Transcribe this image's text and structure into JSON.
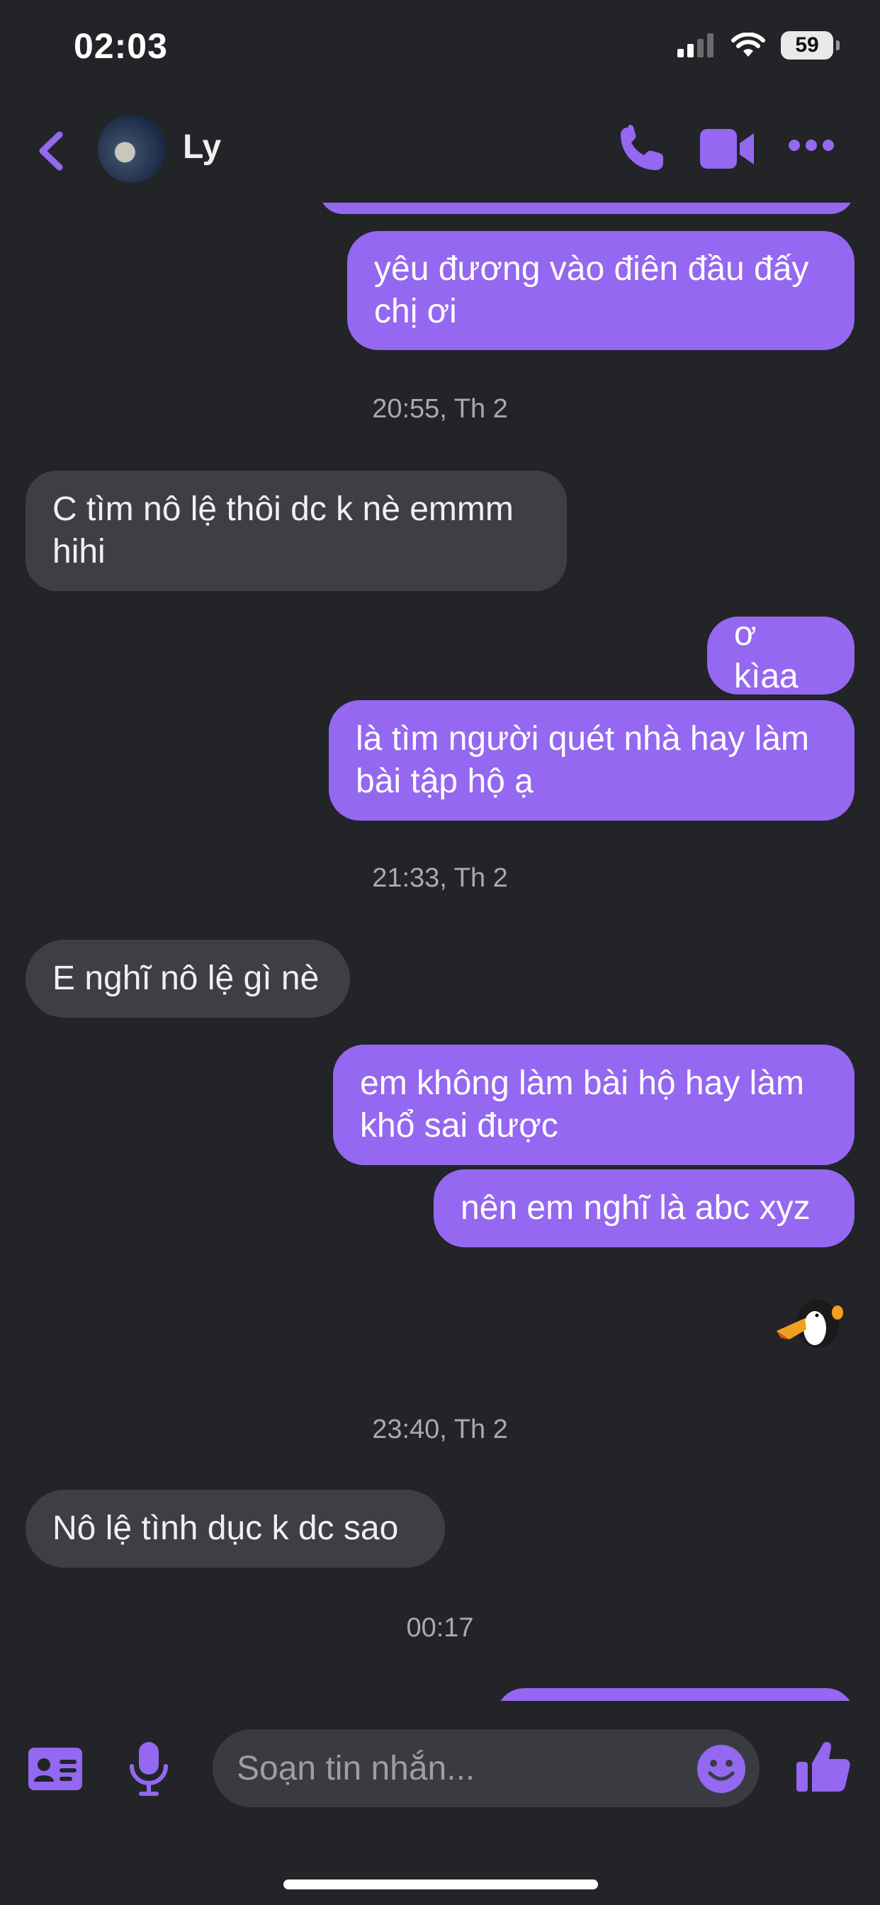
{
  "status_bar": {
    "time": "02:03",
    "battery": "59"
  },
  "header": {
    "contact_name": "Ly"
  },
  "colors": {
    "accent": "#9468f0",
    "incoming_bubble": "#3e3f44",
    "background": "#232428"
  },
  "messages": [
    {
      "type": "outgoing",
      "text": "yêu đương vào điên đầu đấy chị ơi"
    },
    {
      "type": "timestamp",
      "text": "20:55, Th 2"
    },
    {
      "type": "incoming",
      "text": "C tìm nô lệ thôi dc k nè emmm hihi"
    },
    {
      "type": "outgoing",
      "text": "ơ kìaa"
    },
    {
      "type": "outgoing",
      "text": "là tìm người quét nhà hay làm bài tập hộ ạ"
    },
    {
      "type": "timestamp",
      "text": "21:33, Th 2"
    },
    {
      "type": "incoming",
      "text": "E nghĩ nô lệ gì nè"
    },
    {
      "type": "outgoing",
      "text": "em không làm bài hộ hay làm khổ sai được"
    },
    {
      "type": "outgoing",
      "text": "nên em nghĩ là abc xyz"
    },
    {
      "type": "sticker",
      "icon": "toucan-sticker-icon"
    },
    {
      "type": "timestamp",
      "text": "23:40, Th 2"
    },
    {
      "type": "incoming",
      "text": "Nô lệ tình dục k dc sao"
    },
    {
      "type": "timestamp",
      "text": "00:17"
    }
  ],
  "composer": {
    "placeholder": "Soạn tin nhắn..."
  }
}
